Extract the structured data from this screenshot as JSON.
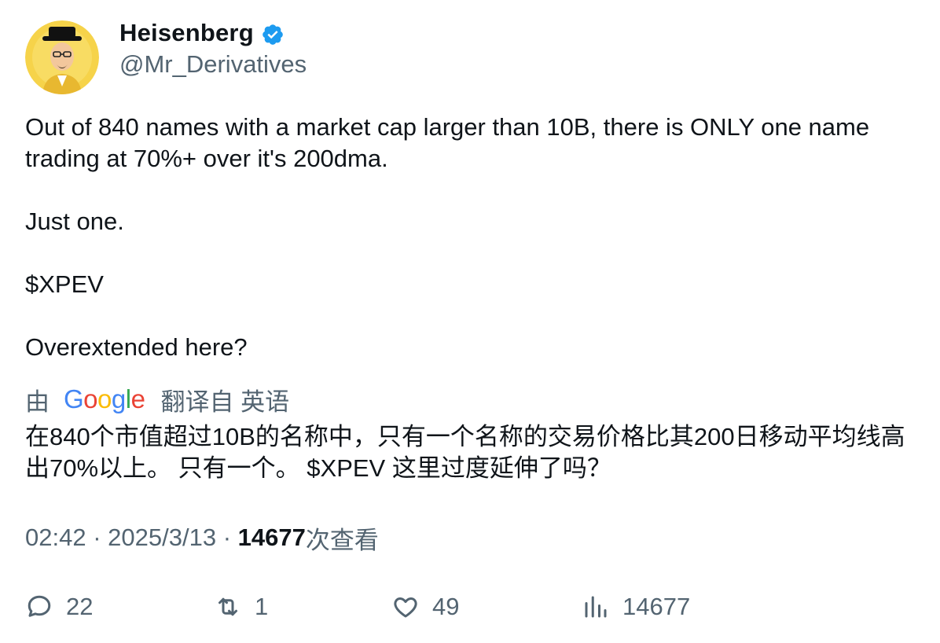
{
  "author": {
    "display_name": "Heisenberg",
    "handle": "@Mr_Derivatives",
    "verified": true,
    "verified_icon": "verified-badge-icon",
    "verified_color": "#1d9bf0"
  },
  "tweet": {
    "paragraphs": [
      "Out of 840 names with a market cap larger than 10B, there is ONLY one name trading at 70%+ over it's 200dma.",
      "Just one.",
      "$XPEV",
      "Overextended here?"
    ]
  },
  "translation": {
    "by_label": "由",
    "provider_logo_letters": [
      "G",
      "o",
      "o",
      "g",
      "l",
      "e"
    ],
    "provider_logo_colors": [
      "#4285F4",
      "#EA4335",
      "#FBBC05",
      "#4285F4",
      "#34A853",
      "#EA4335"
    ],
    "from_label": "翻译自 英语",
    "text": "在840个市值超过10B的名称中，只有一个名称的交易价格比其200日移动平均线高出70%以上。 只有一个。 $XPEV 这里过度延伸了吗？"
  },
  "meta": {
    "time": "02:42",
    "separator": "·",
    "date": "2025/3/13",
    "views_count": "14677",
    "views_label": "次查看"
  },
  "actions": {
    "reply": {
      "icon": "reply-icon",
      "count": "22"
    },
    "retweet": {
      "icon": "retweet-icon",
      "count": "1"
    },
    "like": {
      "icon": "heart-icon",
      "count": "49"
    },
    "views": {
      "icon": "views-chart-icon",
      "count": "14677"
    }
  },
  "colors": {
    "text_primary": "#0f1419",
    "text_secondary": "#536471",
    "background": "#ffffff"
  }
}
